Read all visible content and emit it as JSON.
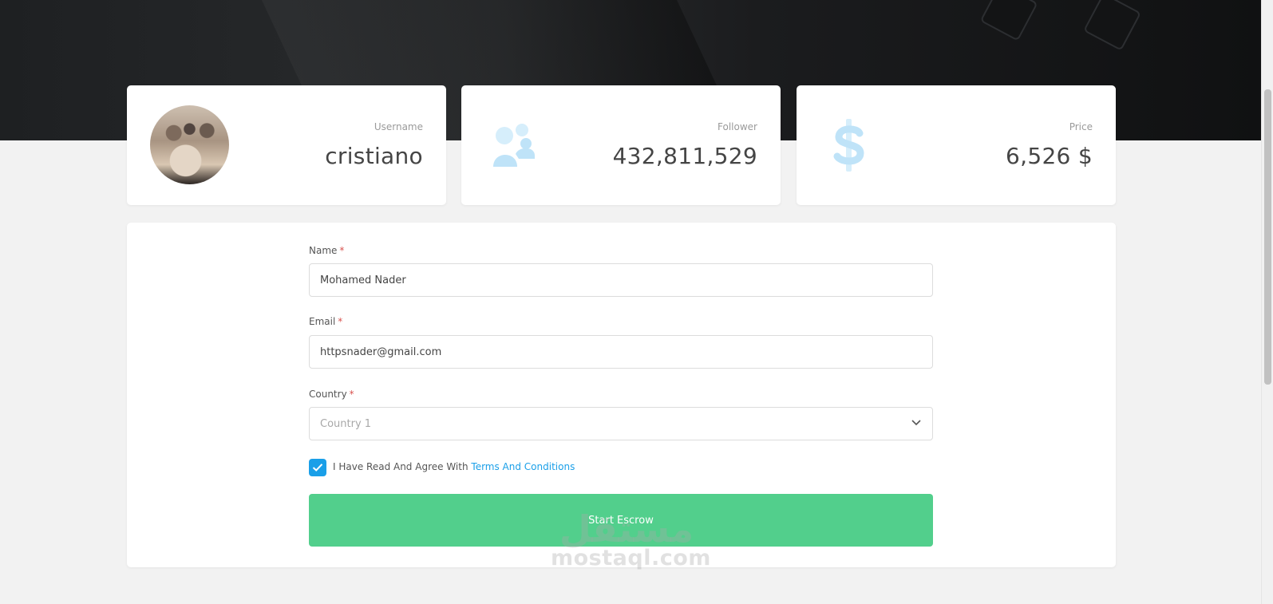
{
  "stats": {
    "username": {
      "label": "Username",
      "value": "cristiano",
      "icon": "avatar-photo"
    },
    "follower": {
      "label": "Follower",
      "value": "432,811,529",
      "icon": "users-icon"
    },
    "price": {
      "label": "Price",
      "value": "6,526 $",
      "icon": "dollar-icon"
    }
  },
  "form": {
    "name": {
      "label": "Name",
      "required": "*",
      "value": "Mohamed Nader"
    },
    "email": {
      "label": "Email",
      "required": "*",
      "value": "httpsnader@gmail.com"
    },
    "country": {
      "label": "Country",
      "required": "*",
      "selected": "Country 1"
    },
    "terms": {
      "checked": true,
      "text": "I Have Read And Agree With",
      "link": "Terms And Conditions"
    },
    "submit_label": "Start Escrow"
  },
  "watermark": {
    "arabic": "مستقل",
    "latin": "mostaql.com"
  },
  "hero_keys": [
    "Q",
    "W",
    "E",
    "2",
    "3",
    "4",
    "5"
  ],
  "colors": {
    "accent_blue": "#1a9fe8",
    "button_green": "#52cf8c",
    "icon_light_blue": "#bfe3f8",
    "hero_dark": "#1e2022"
  }
}
